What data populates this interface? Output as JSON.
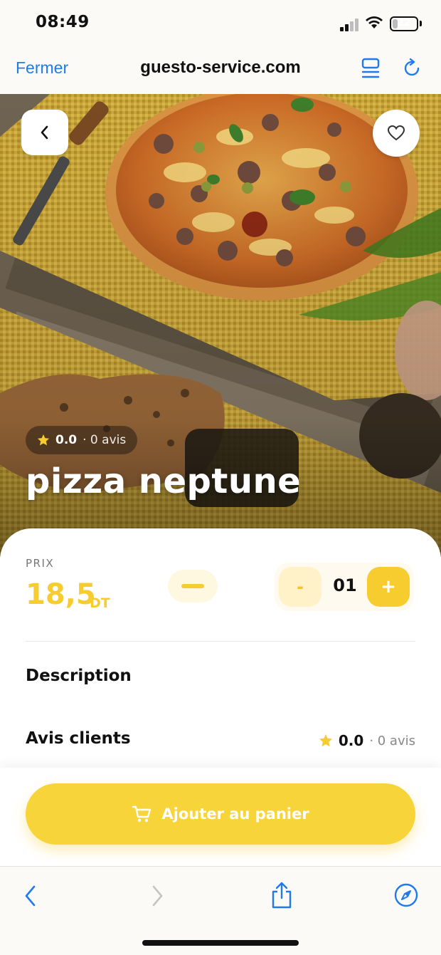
{
  "status_bar": {
    "time": "08:49",
    "battery": "22",
    "battery_fraction": 0.22
  },
  "browser": {
    "close_label": "Fermer",
    "url": "guesto-service.com"
  },
  "product": {
    "rating_value": "0.0",
    "rating_count": "· 0 avis",
    "name": "pizza neptune",
    "price_label": "PRIX",
    "price_value": "18,5",
    "price_unit": "DT",
    "quantity_dec": "-",
    "quantity": "01",
    "quantity_inc": "+"
  },
  "sections": {
    "description_title": "Description",
    "reviews_title": "Avis clients",
    "reviews_rating": "0.0",
    "reviews_count": "· 0 avis"
  },
  "cart": {
    "button_label": "Ajouter au panier"
  },
  "colors": {
    "accent": "#f7cc2e",
    "link": "#1f7aee"
  },
  "icons": [
    "back-icon",
    "heart-icon",
    "star-icon",
    "cart-icon",
    "reader-icon",
    "reload-icon",
    "share-icon",
    "compass-icon"
  ]
}
